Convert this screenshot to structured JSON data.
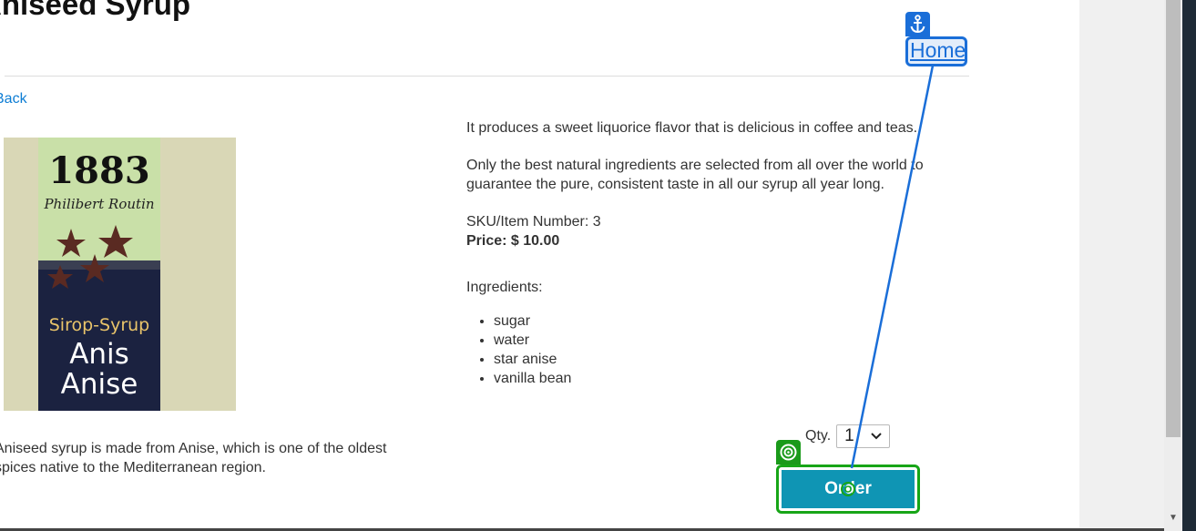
{
  "product": {
    "title": "Aniseed Syrup",
    "back_link": "Back",
    "image_alt": "1883 Philibert Routin Sirop-Syrup Anis Anise bottle label",
    "label_brand": "1883",
    "label_maker": "Philibert Routin",
    "label_line1": "Sirop-Syrup",
    "label_line2": "Anis",
    "label_line3": "Anise",
    "description_left": "Aniseed syrup is made from Anise, which is one of the oldest spices native to the Mediterranean region.",
    "paragraph1": "It produces a sweet liquorice flavor that is delicious in coffee and teas.",
    "paragraph2": "Only the best natural ingredients are selected from all over the world to guarantee the pure, consistent taste in all our syrup all year long.",
    "sku_line": "SKU/Item Number: 3",
    "price_line": "Price: $ 10.00",
    "ingredients_label": "Ingredients:",
    "ingredients": [
      "sugar",
      "water",
      "star anise",
      "vanilla bean"
    ]
  },
  "order_form": {
    "qty_label": "Qty.",
    "qty_value": "1",
    "order_button": "Order"
  },
  "nav": {
    "home_link": "Home"
  },
  "colors": {
    "link_blue": "#0d7dd4",
    "order_button": "#0f95b4",
    "target_highlight": "#17a517",
    "anchor_highlight": "#1a6ed8"
  },
  "icons": {
    "anchor_badge": "anchor-icon",
    "target_badge": "target-icon",
    "cursor": "cursor-ring-icon",
    "qty_dropdown": "chevron-down-icon",
    "scroll_down": "scroll-down-arrow-icon"
  }
}
